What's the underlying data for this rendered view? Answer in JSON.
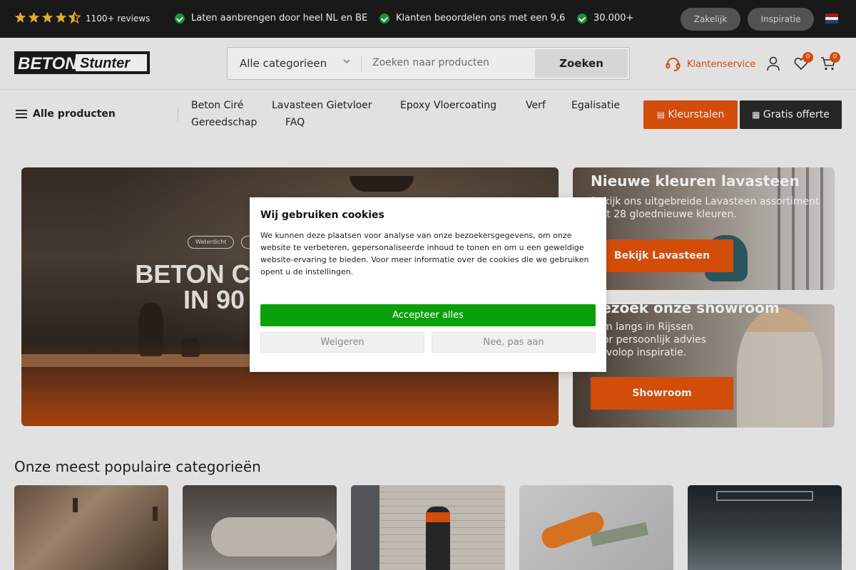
{
  "topbar": {
    "rating": 4.5,
    "reviews": "1100+ reviews",
    "usps": [
      "Laten aanbrengen door heel NL en BE",
      "Klanten beoordelen ons met een 9,6",
      "30.000+"
    ],
    "zakelijk": "Zakelijk",
    "inspiratie": "Inspiratie",
    "flag_icon": "nl-flag-icon"
  },
  "header": {
    "logo_left": "BETON",
    "logo_right": "Stunter",
    "category_select": "Alle categorieen",
    "search_placeholder": "Zoeken naar producten",
    "search_button": "Zoeken",
    "klantenservice": "Klantenservice",
    "wishlist_count": "0",
    "cart_count": "0"
  },
  "nav": {
    "all_products": "Alle producten",
    "links": [
      "Beton Ciré",
      "Lavasteen Gietvloer",
      "Epoxy Vloercoating",
      "Verf",
      "Egalisatie",
      "Gereedschap",
      "FAQ"
    ],
    "kleurstalen": "Kleurstalen",
    "gratis_offerte": "Gratis offerte"
  },
  "hero": {
    "tags": [
      "Waterdicht",
      ""
    ],
    "title_line1": "BETON CIRÉ",
    "title_line2": "IN 90"
  },
  "cards": [
    {
      "title": "Nieuwe kleuren lavasteen",
      "text": "Bekijk ons uitgebreide Lavasteen assortiment met 28 gloednieuwe kleuren.",
      "button": "Bekijk Lavasteen"
    },
    {
      "title": "Bezoek onze showroom",
      "text": "Kom langs in Rijssen voor persoonlijk advies en volop inspiratie.",
      "button": "Showroom"
    }
  ],
  "categories": {
    "title": "Onze meest populaire categorieën"
  },
  "cookie": {
    "title": "Wij gebruiken cookies",
    "text": "We kunnen deze plaatsen voor analyse van onze bezoekersgegevens, om onze website te verbeteren, gepersonaliseerde inhoud te tonen en om u een geweldige website-ervaring te bieden. Voor meer informatie over de cookies die we gebruiken opent u de instellingen.",
    "accept": "Accepteer alles",
    "reject": "Weigeren",
    "customize": "Nee, pas aan"
  },
  "colors": {
    "accent": "#e3530b",
    "accept_green": "#0aa00a",
    "topbar": "#1c1c1c"
  }
}
